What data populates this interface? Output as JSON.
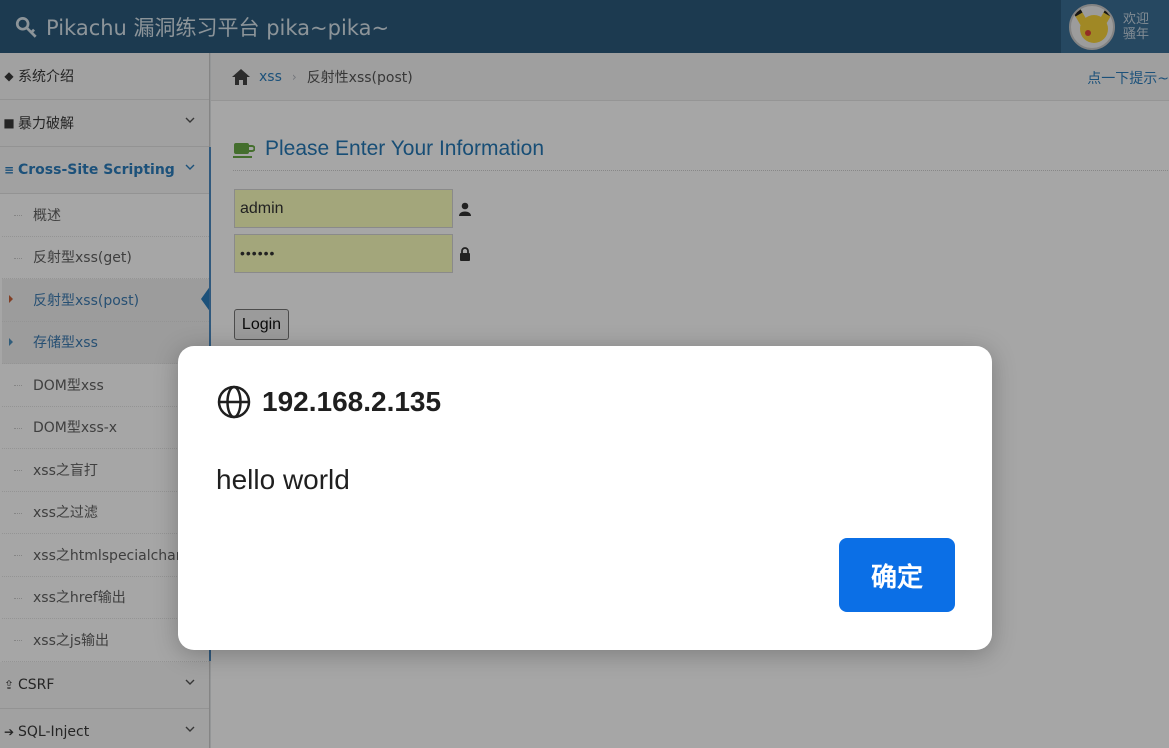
{
  "header": {
    "brand_title": "Pikachu 漏洞练习平台 pika~pika~",
    "welcome_line1": "欢迎",
    "welcome_line2": "骚年"
  },
  "sidebar": {
    "items": [
      {
        "label": "系统介绍",
        "icon": "tag-icon"
      },
      {
        "label": "暴力破解",
        "icon": "lock-icon"
      },
      {
        "label": "Cross-Site Scripting",
        "icon": "list-icon",
        "active": true
      },
      {
        "label": "CSRF",
        "icon": "share-icon"
      },
      {
        "label": "SQL-Inject",
        "icon": "arrow-right-icon"
      }
    ],
    "xss_submenu": [
      "概述",
      "反射型xss(get)",
      "反射型xss(post)",
      "存储型xss",
      "DOM型xss",
      "DOM型xss-x",
      "xss之盲打",
      "xss之过滤",
      "xss之htmlspecialchar",
      "xss之href输出",
      "xss之js输出"
    ],
    "current_index": 2
  },
  "breadcrumb": {
    "link": "xss",
    "current": "反射性xss(post)",
    "hint": "点一下提示~"
  },
  "form": {
    "title": "Please Enter Your Information",
    "username_value": "admin",
    "password_value": "••••••",
    "login_label": "Login"
  },
  "dialog": {
    "origin": "192.168.2.135",
    "message": "hello world",
    "ok_label": "确定"
  },
  "colors": {
    "topbar": "#2c5a7b",
    "accent": "#2b7dbc",
    "autofill": "#faffbd",
    "dialog_button": "#0b6fe6"
  }
}
